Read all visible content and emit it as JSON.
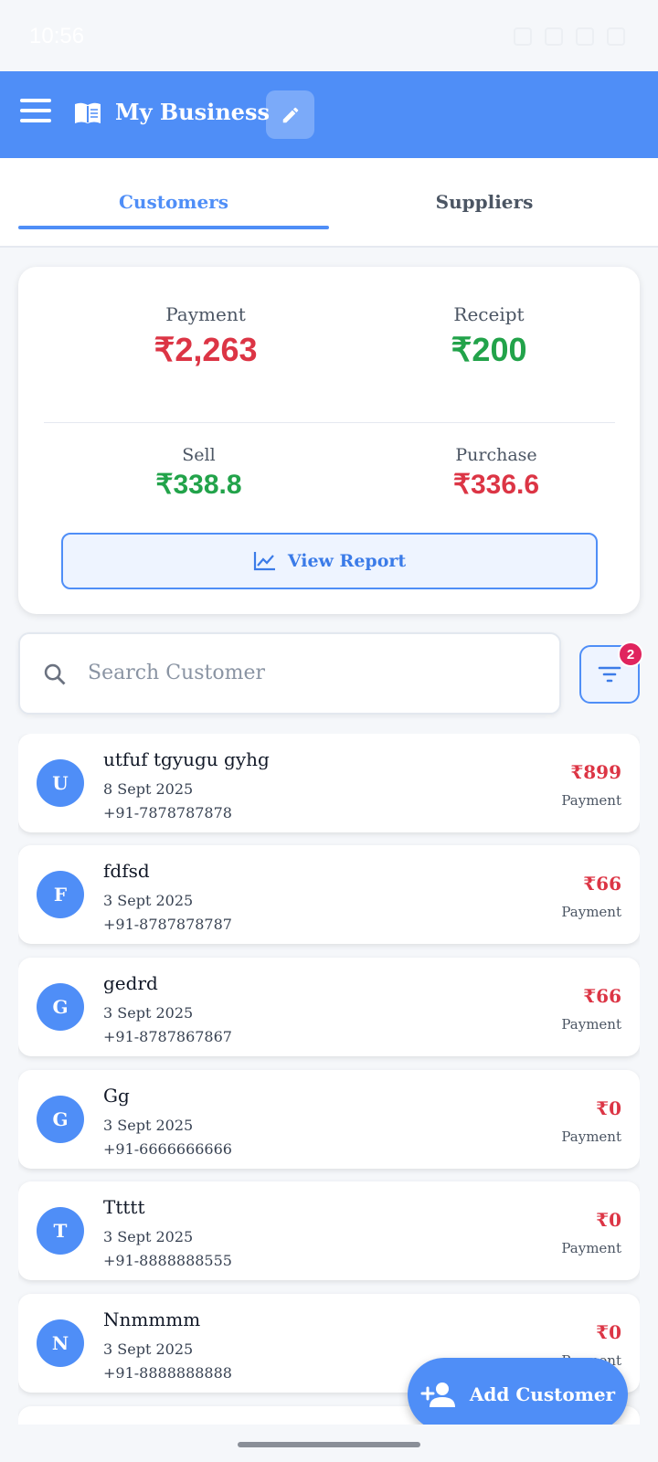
{
  "status_bar": {
    "time": "10:56"
  },
  "app_bar": {
    "title": "My Business"
  },
  "tabs": [
    {
      "label": "Customers",
      "active": true
    },
    {
      "label": "Suppliers",
      "active": false
    }
  ],
  "summary": {
    "payment": {
      "label": "Payment",
      "value": "₹2,263"
    },
    "receipt": {
      "label": "Receipt",
      "value": "₹200"
    },
    "sell": {
      "label": "Sell",
      "value": "₹338.8"
    },
    "purchase": {
      "label": "Purchase",
      "value": "₹336.6"
    },
    "view_report_label": "View Report"
  },
  "search": {
    "placeholder": "Search Customer"
  },
  "filter": {
    "badge_count": "2"
  },
  "customers": [
    {
      "initial": "U",
      "name": "utfuf tgyugu gyhg",
      "date": "8 Sept 2025",
      "phone": "+91-7878787878",
      "amount": "₹899",
      "type": "Payment"
    },
    {
      "initial": "F",
      "name": "fdfsd",
      "date": "3 Sept 2025",
      "phone": "+91-8787878787",
      "amount": "₹66",
      "type": "Payment"
    },
    {
      "initial": "G",
      "name": "gedrd",
      "date": "3 Sept 2025",
      "phone": "+91-8787867867",
      "amount": "₹66",
      "type": "Payment"
    },
    {
      "initial": "G",
      "name": "Gg",
      "date": "3 Sept 2025",
      "phone": "+91-6666666666",
      "amount": "₹0",
      "type": "Payment"
    },
    {
      "initial": "T",
      "name": "Ttttt",
      "date": "3 Sept 2025",
      "phone": "+91-8888888555",
      "amount": "₹0",
      "type": "Payment"
    },
    {
      "initial": "N",
      "name": "Nnmmmm",
      "date": "3 Sept 2025",
      "phone": "+91-8888888888",
      "amount": "₹0",
      "type": "Payment"
    }
  ],
  "fab": {
    "label": "Add Customer"
  },
  "colors": {
    "primary": "#4f8ef7",
    "negative": "#dc3545",
    "positive": "#22a34a",
    "badge": "#e0245e"
  }
}
